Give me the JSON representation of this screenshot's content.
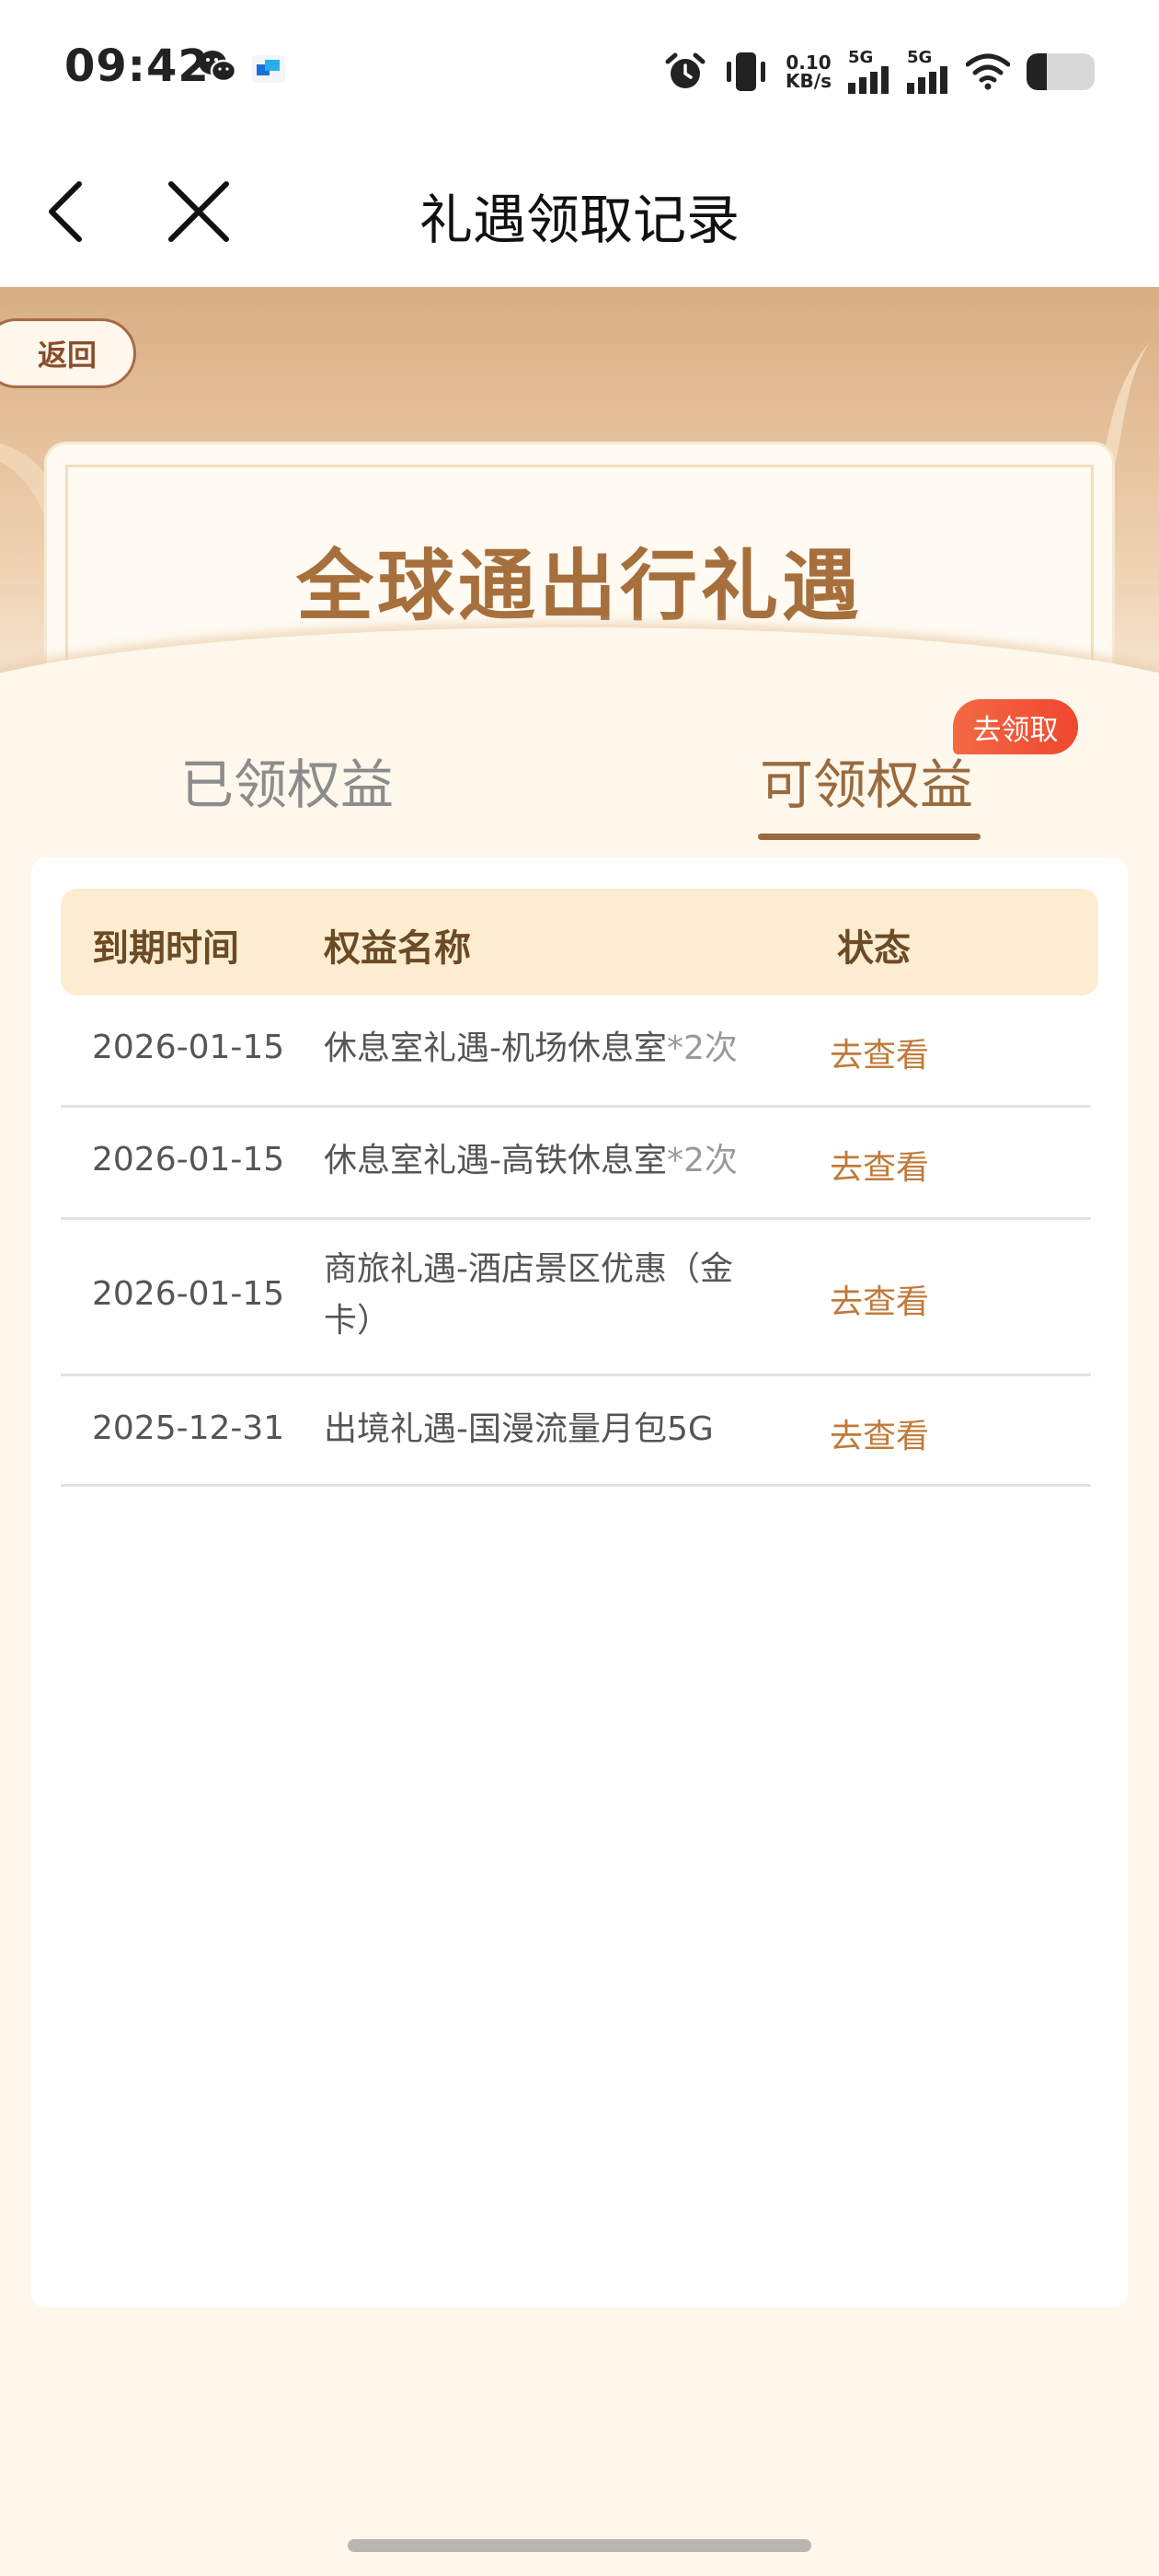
{
  "status_bar": {
    "time": "09:42",
    "net_speed_value": "0.10",
    "net_speed_unit": "KB/s",
    "signal_1_label": "5G",
    "signal_2_label": "5G",
    "battery_level": 0.3,
    "icons": [
      "wechat-icon",
      "app-icon",
      "alarm-icon",
      "vibrate-icon",
      "signal-icon",
      "wifi-icon",
      "battery-icon"
    ]
  },
  "nav": {
    "title": "礼遇领取记录",
    "back_icon": "chevron-left-icon",
    "close_icon": "close-icon"
  },
  "banner": {
    "back_label": "返回",
    "title": "全球通出行礼遇"
  },
  "tabs": {
    "received": "已领权益",
    "available": "可领权益",
    "badge": "去领取",
    "active": "available"
  },
  "table": {
    "headers": {
      "date": "到期时间",
      "name": "权益名称",
      "status": "状态"
    },
    "rows": [
      {
        "date": "2026-01-15",
        "name": "休息室礼遇-机场休息室",
        "times": "*2次",
        "status": "去查看"
      },
      {
        "date": "2026-01-15",
        "name": "休息室礼遇-高铁休息室",
        "times": "*2次",
        "status": "去查看"
      },
      {
        "date": "2026-01-15",
        "name": "商旅礼遇-酒店景区优惠（金卡）",
        "times": "",
        "status": "去查看"
      },
      {
        "date": "2025-12-31",
        "name": "出境礼遇-国漫流量月包5G",
        "times": "",
        "status": "去查看"
      }
    ]
  },
  "colors": {
    "accent_brown": "#9a6a3d",
    "status_orange": "#c07a3a",
    "badge_red": "#f0472e",
    "header_bg": "#fdedd0",
    "page_bg": "#fdf7ec"
  }
}
